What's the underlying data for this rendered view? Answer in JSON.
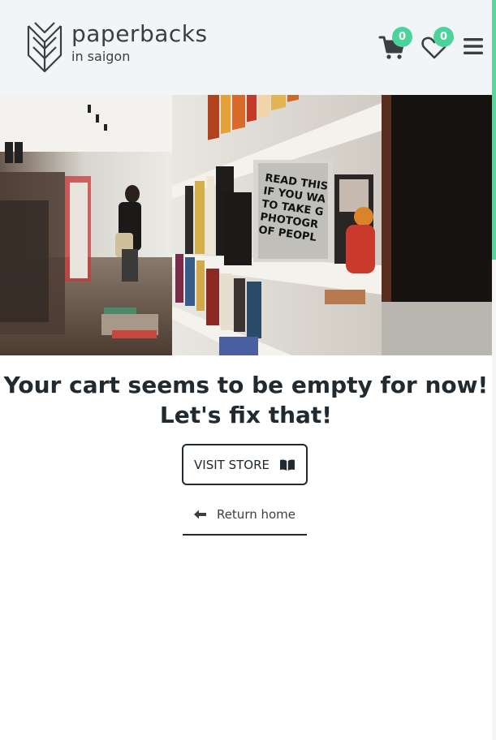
{
  "brand": {
    "name": "paperbacks",
    "tagline": "in saigon"
  },
  "header": {
    "cart_count": "0",
    "wishlist_count": "0",
    "accent_color": "#4cd39b"
  },
  "hero": {
    "alt": "Bookstore interior with shelves of books"
  },
  "main": {
    "empty_line1": "Your cart seems to be empty for now!",
    "empty_line2": "Let's fix that!",
    "visit_store_label": "VISIT STORE",
    "return_home_label": "Return home"
  },
  "icons": {
    "logo": "book-leaf-logo",
    "cart": "cart-icon",
    "wishlist": "heart-icon",
    "menu": "hamburger-icon",
    "store": "open-book-icon",
    "back": "arrow-left-icon"
  }
}
